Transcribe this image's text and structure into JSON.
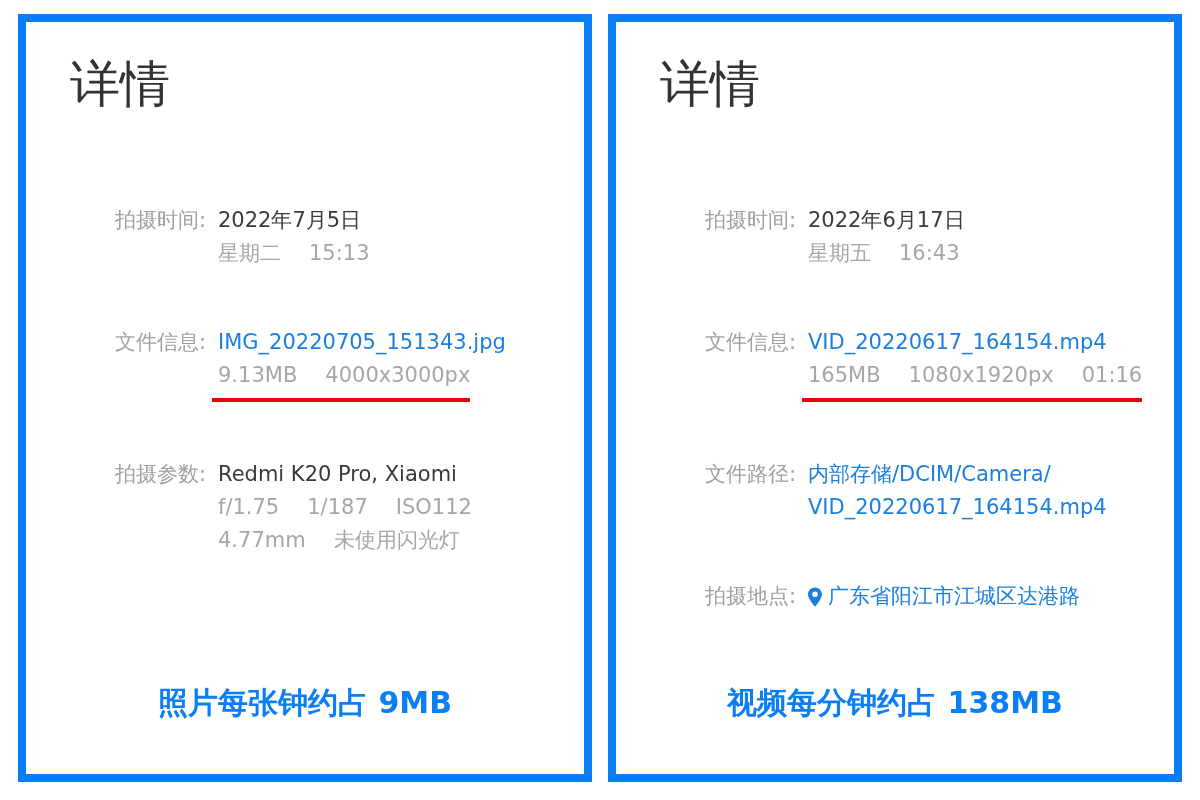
{
  "panels": [
    {
      "title": "详情",
      "rows": [
        {
          "label": "拍摄时间:",
          "lines": [
            {
              "kind": "primary",
              "parts": [
                "2022年7月5日"
              ]
            },
            {
              "kind": "secondary",
              "parts": [
                "星期二",
                "15:13"
              ]
            }
          ]
        },
        {
          "label": "文件信息:",
          "lines": [
            {
              "kind": "link",
              "parts": [
                "IMG_20220705_151343.jpg"
              ]
            },
            {
              "kind": "secondary",
              "underlined": true,
              "parts": [
                "9.13MB",
                "4000x3000px"
              ]
            }
          ]
        },
        {
          "label": "拍摄参数:",
          "lines": [
            {
              "kind": "primary",
              "parts": [
                "Redmi K20 Pro, Xiaomi"
              ]
            },
            {
              "kind": "secondary",
              "parts": [
                "f/1.75",
                "1/187",
                "ISO112"
              ]
            },
            {
              "kind": "secondary",
              "parts": [
                "4.77mm",
                "未使用闪光灯"
              ]
            }
          ]
        }
      ],
      "caption": "照片每张钟约占 9MB"
    },
    {
      "title": "详情",
      "rows": [
        {
          "label": "拍摄时间:",
          "lines": [
            {
              "kind": "primary",
              "parts": [
                "2022年6月17日"
              ]
            },
            {
              "kind": "secondary",
              "parts": [
                "星期五",
                "16:43"
              ]
            }
          ]
        },
        {
          "label": "文件信息:",
          "lines": [
            {
              "kind": "link",
              "parts": [
                "VID_20220617_164154.mp4"
              ]
            },
            {
              "kind": "secondary",
              "underlined": true,
              "parts": [
                "165MB",
                "1080x1920px",
                "01:16"
              ]
            }
          ]
        },
        {
          "label": "文件路径:",
          "lines": [
            {
              "kind": "link",
              "parts": [
                "内部存储/DCIM/Camera/"
              ]
            },
            {
              "kind": "link",
              "parts": [
                "VID_20220617_164154.mp4"
              ]
            }
          ]
        },
        {
          "label": "拍摄地点:",
          "lines": [
            {
              "kind": "location",
              "parts": [
                "广东省阳江市江城区达港路"
              ]
            }
          ]
        }
      ],
      "caption": "视频每分钟约占 138MB"
    }
  ]
}
